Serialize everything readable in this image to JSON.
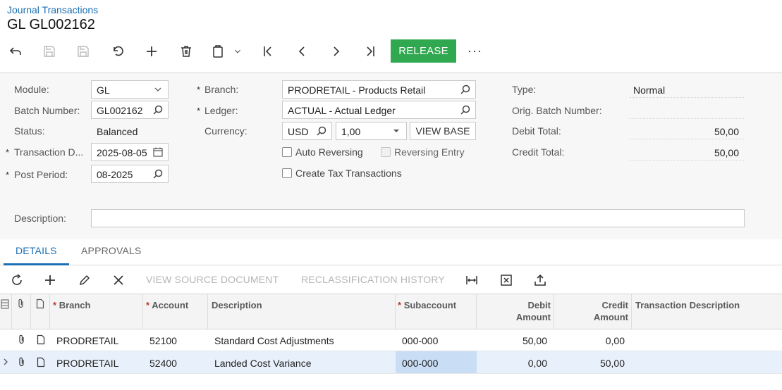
{
  "header": {
    "breadcrumb": "Journal Transactions",
    "title": "GL GL002162"
  },
  "toolbar": {
    "release_label": "RELEASE",
    "more_label": "···"
  },
  "form": {
    "module": {
      "label": "Module:",
      "value": "GL"
    },
    "batch_number": {
      "label": "Batch Number:",
      "value": "GL002162"
    },
    "status": {
      "label": "Status:",
      "value": "Balanced"
    },
    "transaction_date": {
      "label": "Transaction D...",
      "value": "2025-08-05"
    },
    "post_period": {
      "label": "Post Period:",
      "value": "08-2025"
    },
    "branch": {
      "label": "Branch:",
      "value": "PRODRETAIL - Products Retail"
    },
    "ledger": {
      "label": "Ledger:",
      "value": "ACTUAL - Actual Ledger"
    },
    "currency": {
      "label": "Currency:",
      "value": "USD",
      "rate": "1,00",
      "view_base_label": "VIEW BASE"
    },
    "auto_reversing": {
      "label": "Auto Reversing",
      "checked": false
    },
    "reversing_entry": {
      "label": "Reversing Entry",
      "checked": false
    },
    "create_tax": {
      "label": "Create Tax Transactions",
      "checked": false
    },
    "type": {
      "label": "Type:",
      "value": "Normal"
    },
    "orig_batch": {
      "label": "Orig. Batch Number:",
      "value": ""
    },
    "debit_total": {
      "label": "Debit Total:",
      "value": "50,00"
    },
    "credit_total": {
      "label": "Credit Total:",
      "value": "50,00"
    },
    "description": {
      "label": "Description:",
      "value": ""
    },
    "required_mark": "*"
  },
  "tabs": [
    {
      "label": "DETAILS",
      "active": true
    },
    {
      "label": "APPROVALS",
      "active": false
    }
  ],
  "grid_toolbar": {
    "view_source_label": "VIEW SOURCE DOCUMENT",
    "reclass_history_label": "RECLASSIFICATION HISTORY"
  },
  "grid": {
    "columns": {
      "branch": "Branch",
      "account": "Account",
      "description": "Description",
      "subaccount": "Subaccount",
      "debit_line1": "Debit",
      "debit_line2": "Amount",
      "credit_line1": "Credit",
      "credit_line2": "Amount",
      "trans_desc": "Transaction Description"
    },
    "rows": [
      {
        "branch": "PRODRETAIL",
        "account": "52100",
        "description": "Standard Cost Adjustments",
        "subaccount": "000-000",
        "debit": "50,00",
        "credit": "0,00",
        "trans_desc": ""
      },
      {
        "branch": "PRODRETAIL",
        "account": "52400",
        "description": "Landed Cost Variance",
        "subaccount": "000-000",
        "debit": "0,00",
        "credit": "50,00",
        "trans_desc": ""
      }
    ]
  },
  "colors": {
    "accent": "#1b6fb3",
    "release": "#2fa84f",
    "selected_row": "#e8f1fb"
  }
}
